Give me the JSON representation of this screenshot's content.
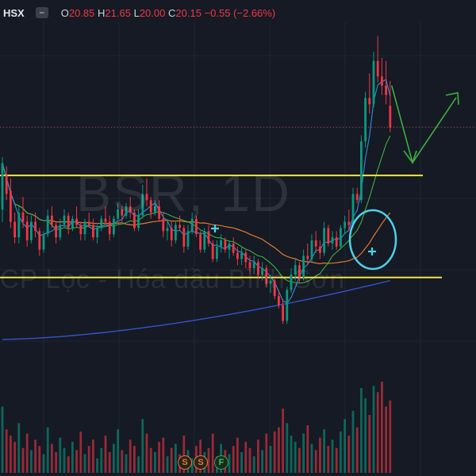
{
  "header": {
    "exchange": "HSX",
    "collapse_symbol": "−",
    "open_label": "O",
    "open": "20.85",
    "high_label": "H",
    "high": "21.65",
    "low_label": "L",
    "low": "20.00",
    "close_label": "C",
    "close": "20.15",
    "change": "−0.55 (−2.66%)"
  },
  "watermark": {
    "symbol": "BSR, 1D",
    "company": "CP Lọc - Hóa dầu Bình Sơn"
  },
  "badges": [
    "S",
    "S",
    "F"
  ],
  "colors": {
    "background": "#151a24",
    "candle_down": "#f23645",
    "candle_up": "#089981",
    "support_line": "#f5e342",
    "ma_fast": "#2f8fd8",
    "ma_medium": "#3cb043",
    "ma_slow": "#e07a2f",
    "ma_long": "#3554c8",
    "annotation": "#4fd1e8",
    "arrow": "#3cb043"
  },
  "chart_data": {
    "type": "candlestick",
    "price_range": [
      13.5,
      23.5
    ],
    "last_price": 20.15,
    "support_levels": [
      18.6,
      15.3
    ],
    "candles": [
      [
        17.5,
        19.2,
        17.1,
        19.0
      ],
      [
        18.6,
        18.9,
        17.8,
        18.0
      ],
      [
        18.1,
        18.5,
        16.9,
        17.1
      ],
      [
        17.1,
        17.4,
        16.4,
        16.6
      ],
      [
        16.6,
        17.6,
        16.4,
        17.4
      ],
      [
        17.4,
        17.9,
        16.9,
        17.1
      ],
      [
        17.1,
        17.3,
        16.3,
        16.5
      ],
      [
        16.5,
        17.3,
        16.4,
        17.1
      ],
      [
        17.1,
        17.4,
        16.6,
        16.8
      ],
      [
        16.8,
        16.9,
        16.0,
        16.2
      ],
      [
        16.2,
        16.8,
        16.1,
        16.7
      ],
      [
        16.7,
        17.5,
        16.6,
        17.3
      ],
      [
        17.3,
        17.6,
        16.9,
        17.0
      ],
      [
        17.0,
        17.1,
        16.4,
        16.6
      ],
      [
        16.6,
        17.2,
        16.5,
        17.0
      ],
      [
        17.0,
        17.5,
        16.9,
        17.3
      ],
      [
        17.3,
        17.4,
        16.7,
        16.9
      ],
      [
        16.9,
        17.3,
        16.8,
        17.2
      ],
      [
        17.2,
        17.6,
        16.9,
        17.0
      ],
      [
        17.0,
        17.1,
        16.5,
        16.7
      ],
      [
        16.7,
        17.2,
        16.5,
        17.1
      ],
      [
        17.1,
        17.4,
        16.9,
        17.0
      ],
      [
        17.0,
        17.2,
        16.5,
        16.6
      ],
      [
        16.6,
        17.0,
        16.4,
        16.9
      ],
      [
        16.9,
        17.3,
        16.8,
        17.2
      ],
      [
        17.2,
        17.6,
        17.0,
        17.1
      ],
      [
        17.1,
        17.3,
        16.5,
        16.7
      ],
      [
        16.7,
        17.3,
        16.6,
        17.2
      ],
      [
        17.2,
        17.7,
        17.1,
        17.5
      ],
      [
        17.5,
        17.6,
        17.1,
        17.3
      ],
      [
        17.3,
        17.7,
        17.2,
        17.6
      ],
      [
        17.6,
        17.9,
        17.2,
        17.4
      ],
      [
        17.4,
        17.5,
        16.8,
        16.9
      ],
      [
        16.9,
        17.5,
        16.8,
        17.3
      ],
      [
        17.3,
        18.3,
        17.2,
        18.0
      ],
      [
        18.0,
        18.5,
        17.6,
        17.8
      ],
      [
        17.8,
        17.9,
        17.2,
        17.4
      ],
      [
        17.4,
        17.8,
        17.3,
        17.6
      ],
      [
        17.6,
        17.8,
        17.1,
        17.2
      ],
      [
        17.2,
        17.4,
        16.6,
        16.8
      ],
      [
        16.8,
        17.2,
        16.5,
        16.9
      ],
      [
        16.9,
        17.1,
        16.3,
        16.5
      ],
      [
        16.5,
        17.1,
        16.4,
        17.0
      ],
      [
        17.0,
        17.3,
        16.8,
        16.9
      ],
      [
        16.9,
        17.0,
        16.1,
        16.3
      ],
      [
        16.3,
        17.0,
        16.2,
        16.8
      ],
      [
        16.8,
        17.4,
        16.7,
        17.2
      ],
      [
        17.2,
        17.3,
        16.6,
        16.7
      ],
      [
        16.7,
        16.8,
        16.1,
        16.2
      ],
      [
        16.2,
        16.9,
        16.1,
        16.8
      ],
      [
        16.8,
        17.0,
        16.3,
        16.4
      ],
      [
        16.4,
        16.5,
        15.8,
        15.9
      ],
      [
        15.9,
        16.5,
        15.8,
        16.3
      ],
      [
        16.3,
        16.7,
        16.1,
        16.5
      ],
      [
        16.5,
        16.6,
        16.1,
        16.2
      ],
      [
        16.2,
        16.5,
        15.9,
        16.4
      ],
      [
        16.4,
        16.6,
        16.0,
        16.1
      ],
      [
        16.1,
        16.3,
        15.7,
        15.9
      ],
      [
        15.9,
        16.3,
        15.7,
        16.1
      ],
      [
        16.1,
        16.2,
        15.6,
        15.8
      ],
      [
        15.8,
        16.0,
        15.4,
        15.6
      ],
      [
        15.6,
        16.0,
        15.4,
        15.8
      ],
      [
        15.8,
        15.9,
        15.3,
        15.4
      ],
      [
        15.4,
        15.8,
        15.2,
        15.6
      ],
      [
        15.6,
        15.7,
        15.0,
        15.1
      ],
      [
        15.1,
        15.4,
        14.8,
        15.2
      ],
      [
        15.2,
        15.3,
        14.6,
        14.7
      ],
      [
        14.7,
        14.9,
        14.3,
        14.4
      ],
      [
        14.4,
        14.6,
        13.8,
        13.9
      ],
      [
        13.9,
        15.0,
        13.8,
        14.9
      ],
      [
        14.9,
        15.6,
        14.8,
        15.4
      ],
      [
        15.4,
        15.9,
        15.2,
        15.7
      ],
      [
        15.7,
        15.8,
        15.1,
        15.3
      ],
      [
        15.3,
        16.2,
        15.2,
        16.0
      ],
      [
        16.0,
        16.4,
        15.7,
        15.9
      ],
      [
        15.9,
        16.7,
        15.8,
        16.5
      ],
      [
        16.5,
        16.8,
        16.1,
        16.3
      ],
      [
        16.3,
        16.5,
        15.9,
        16.1
      ],
      [
        16.1,
        17.1,
        16.0,
        16.9
      ],
      [
        16.9,
        17.0,
        16.3,
        16.4
      ],
      [
        16.4,
        16.8,
        16.2,
        16.6
      ],
      [
        16.6,
        16.8,
        16.2,
        16.3
      ],
      [
        16.3,
        17.0,
        16.2,
        16.9
      ],
      [
        16.9,
        17.3,
        16.7,
        17.1
      ],
      [
        17.1,
        17.5,
        16.8,
        17.0
      ],
      [
        17.0,
        18.2,
        16.9,
        18.0
      ],
      [
        18.0,
        18.2,
        17.7,
        17.8
      ],
      [
        17.8,
        19.9,
        17.7,
        19.7
      ],
      [
        19.7,
        21.3,
        19.5,
        21.1
      ],
      [
        21.1,
        21.9,
        20.6,
        20.9
      ],
      [
        20.9,
        22.6,
        20.8,
        22.3
      ],
      [
        22.3,
        23.1,
        21.6,
        21.8
      ],
      [
        21.8,
        22.4,
        21.2,
        21.5
      ],
      [
        21.5,
        22.3,
        20.9,
        21.2
      ],
      [
        20.85,
        21.65,
        20.0,
        20.15
      ]
    ],
    "volumes": [
      3.2,
      2.1,
      1.8,
      1.5,
      2.4,
      1.2,
      1.9,
      1.1,
      1.6,
      1.3,
      0.9,
      2.2,
      1.4,
      1.0,
      1.7,
      1.2,
      0.8,
      1.5,
      1.1,
      2.0,
      0.9,
      1.3,
      1.6,
      0.7,
      1.2,
      1.8,
      1.0,
      1.4,
      2.1,
      1.1,
      0.9,
      1.6,
      1.3,
      0.8,
      2.6,
      1.9,
      1.2,
      1.0,
      1.5,
      1.7,
      0.8,
      1.2,
      1.4,
      0.9,
      1.8,
      1.1,
      0.7,
      1.3,
      1.6,
      1.0,
      1.2,
      1.9,
      0.8,
      1.4,
      1.1,
      0.9,
      1.3,
      1.7,
      1.0,
      1.5,
      1.2,
      0.8,
      1.6,
      1.1,
      1.9,
      1.3,
      2.0,
      2.2,
      3.1,
      2.4,
      1.8,
      1.5,
      1.2,
      1.9,
      2.3,
      1.4,
      1.1,
      1.7,
      2.1,
      1.3,
      1.6,
      1.2,
      2.0,
      2.6,
      1.8,
      3.0,
      2.2,
      4.1,
      3.6,
      2.8,
      4.2,
      3.9,
      4.4,
      3.2,
      3.5
    ],
    "volume_max": 4.6
  }
}
